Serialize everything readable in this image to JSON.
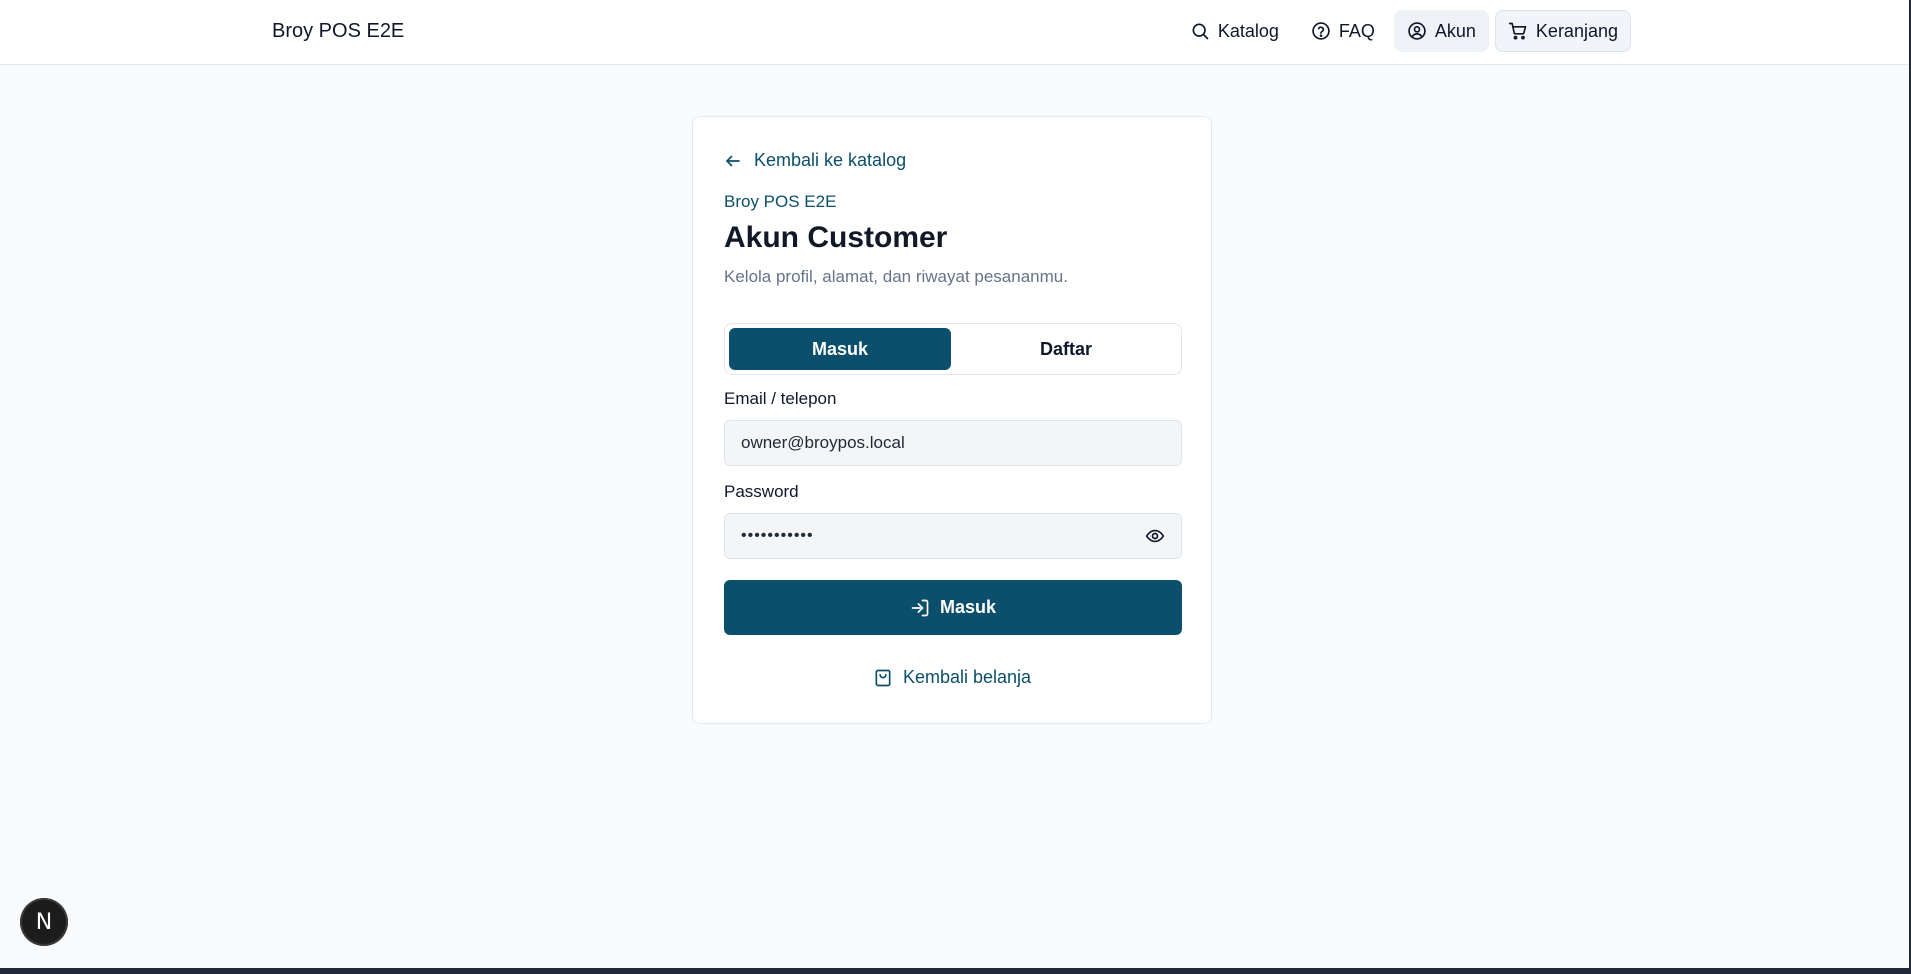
{
  "header": {
    "brand": "Broy POS E2E",
    "nav": {
      "catalog": "Katalog",
      "faq": "FAQ",
      "account": "Akun",
      "cart": "Keranjang"
    }
  },
  "card": {
    "back_link": "Kembali ke katalog",
    "eyebrow": "Broy POS E2E",
    "title": "Akun Customer",
    "subtitle": "Kelola profil, alamat, dan riwayat pesananmu.",
    "tabs": {
      "login": "Masuk",
      "register": "Daftar",
      "active": "login"
    },
    "email": {
      "label": "Email / telepon",
      "value": "owner@broypos.local"
    },
    "password": {
      "label": "Password",
      "masked_value": "•••••••••••"
    },
    "submit_label": "Masuk",
    "shop_link": "Kembali belanja"
  },
  "devtools_badge": "N",
  "colors": {
    "primary": "#0b4f6c",
    "background": "#f8fafc",
    "muted_text": "#64748b"
  },
  "icons": {
    "catalog": "search-icon",
    "faq": "help-circle-icon",
    "account": "user-circle-icon",
    "cart": "cart-icon",
    "back": "arrow-left-icon",
    "password_toggle": "eye-icon",
    "submit": "log-in-icon",
    "shop": "shopping-bag-icon"
  }
}
